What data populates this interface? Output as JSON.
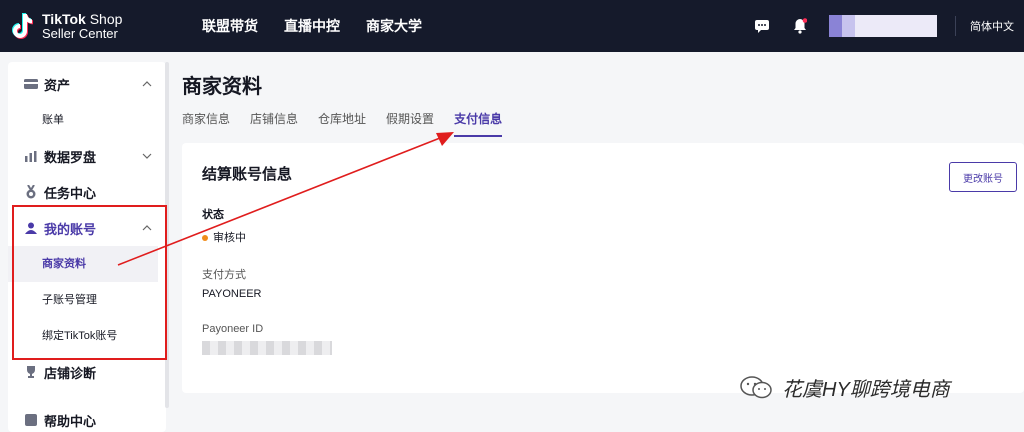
{
  "header": {
    "logo_line1": "TikTok",
    "logo_line1_suffix": "Shop",
    "logo_line2": "Seller Center",
    "nav": [
      "联盟带货",
      "直播中控",
      "商家大学"
    ],
    "language": "简体中文"
  },
  "sidebar": {
    "groups": [
      {
        "label": "资产",
        "icon": "wallet-icon",
        "expanded": true,
        "items": [
          "账单"
        ]
      },
      {
        "label": "数据罗盘",
        "icon": "bar-chart-icon",
        "expanded": false,
        "items": []
      },
      {
        "label": "任务中心",
        "icon": "medal-icon",
        "expanded": false,
        "items": []
      },
      {
        "label": "我的账号",
        "icon": "user-icon",
        "expanded": true,
        "items": [
          "商家资料",
          "子账号管理",
          "绑定TikTok账号"
        ]
      },
      {
        "label": "店铺诊断",
        "icon": "trophy-icon",
        "expanded": false,
        "items": []
      },
      {
        "label": "帮助中心",
        "icon": "help-icon",
        "expanded": false,
        "items": []
      }
    ],
    "active_item": "商家资料"
  },
  "page": {
    "title": "商家资料",
    "tabs": [
      "商家信息",
      "店铺信息",
      "仓库地址",
      "假期设置",
      "支付信息"
    ],
    "active_tab": "支付信息"
  },
  "card": {
    "title": "结算账号信息",
    "change_button": "更改账号",
    "status_label": "状态",
    "status_value": "审核中",
    "payment_label": "支付方式",
    "payment_value": "PAYONEER",
    "payoneer_id_label": "Payoneer ID"
  },
  "watermark": "花虞HY聊跨境电商",
  "colors": {
    "topbar": "#151a2b",
    "accent": "#4a3aa8",
    "annotation_red": "#e01d1d",
    "status_orange": "#f08c1a"
  }
}
